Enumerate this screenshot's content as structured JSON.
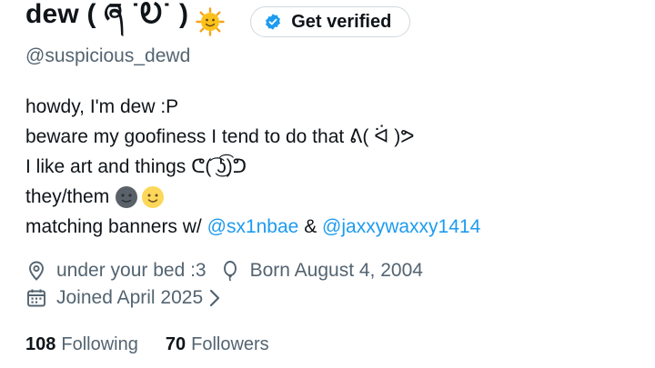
{
  "profile": {
    "display_name": "dew ( ཞ ˙Ꭷ˙ )",
    "handle": "@suspicious_dewd",
    "verify_button": "Get verified"
  },
  "bio": {
    "line1": "howdy, I'm dew :P",
    "line2": "beware my goofiness I tend to do that ᕕ( ᐛ )ᕗ",
    "line3": "I like art and things ᕦ(͡ ͜ʖ͡)ᕤ",
    "line4": "they/them",
    "line5_prefix": "matching banners w/",
    "mention1": "@sx1nbae",
    "amp": "&",
    "mention2": "@jaxxywaxxy1414"
  },
  "meta": {
    "location": "under your bed :3",
    "birthday": "Born August 4, 2004",
    "joined": "Joined April 2025"
  },
  "counts": {
    "following_num": "108",
    "following_label": "Following",
    "followers_num": "70",
    "followers_label": "Followers"
  },
  "icons": {
    "verified": "verified-badge-icon",
    "location": "location-pin-icon",
    "birthday": "balloon-icon",
    "calendar": "calendar-icon",
    "chevron": "chevron-right-icon",
    "sun": "sun-face-emoji",
    "moon": "new-moon-face-emoji",
    "smile": "smiling-face-emoji"
  },
  "colors": {
    "accent": "#1d9bf0",
    "text": "#0f1419",
    "muted": "#536471"
  }
}
